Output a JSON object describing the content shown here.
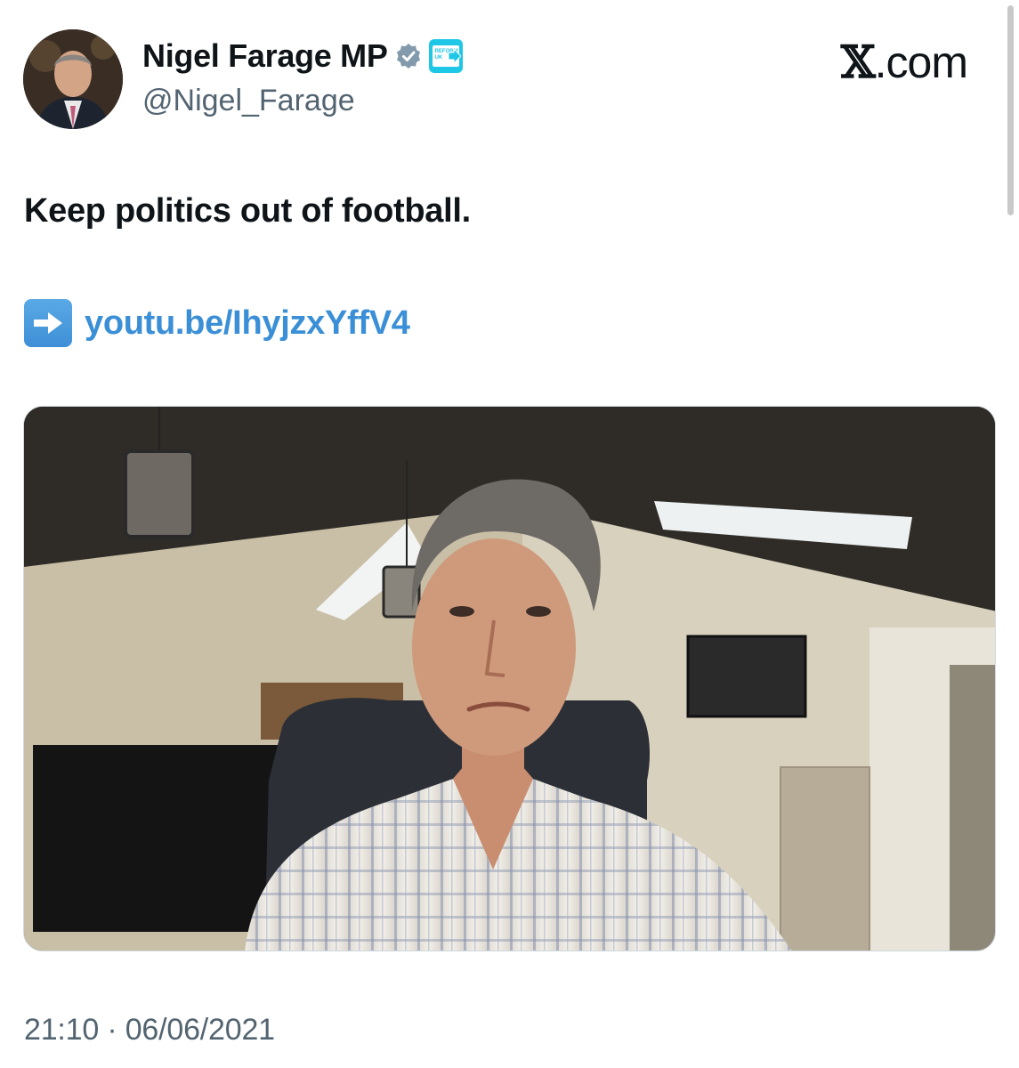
{
  "author": {
    "display_name": "Nigel Farage MP",
    "handle": "@Nigel_Farage",
    "affiliate_badge_text": "REFORM UK",
    "avatar_icon": "profile-photo"
  },
  "brand": {
    "label": ".com",
    "logo_glyph": "𝕏"
  },
  "tweet": {
    "text": "Keep politics out of football.",
    "link_icon": "➡",
    "link_text": "youtu.be/IhyjzxYffV4",
    "timestamp": "21:10 · 06/06/2021"
  },
  "colors": {
    "link": "#3a8fd6",
    "verified": "#829aab",
    "affiliate": "#1ec7e6",
    "secondary_text": "#536471"
  }
}
